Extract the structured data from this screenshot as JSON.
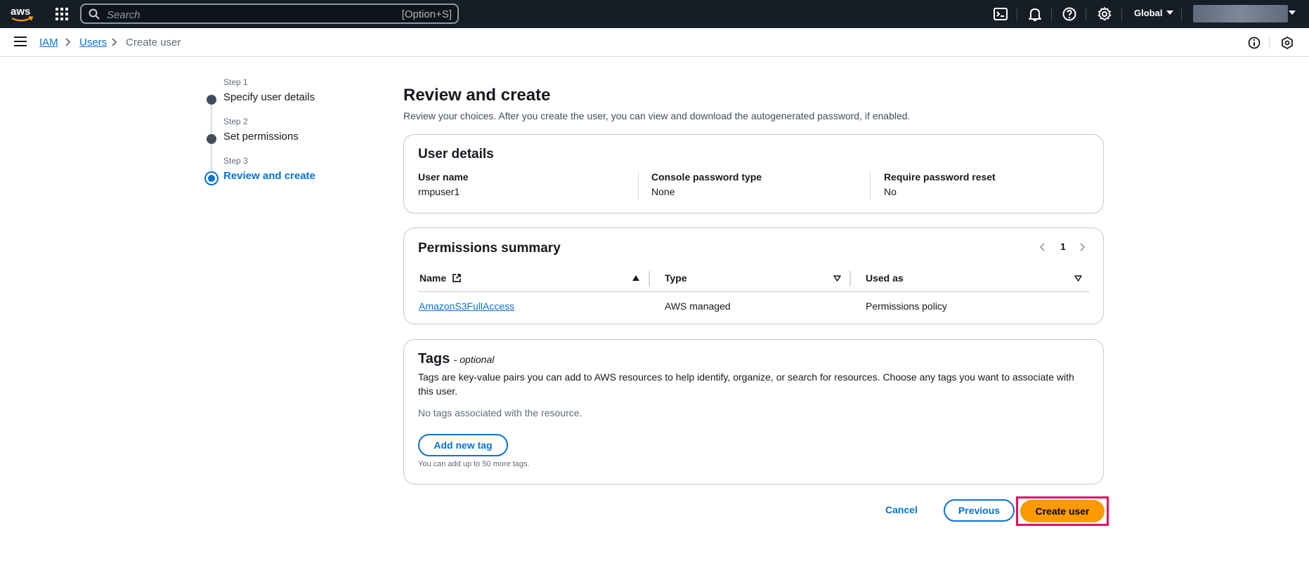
{
  "topnav": {
    "logo_text": "aws",
    "search_placeholder": "Search",
    "search_shortcut": "[Option+S]",
    "region": "Global",
    "icons": [
      "apps-grid-icon",
      "cloudshell-icon",
      "bell-icon",
      "help-icon",
      "settings-icon"
    ],
    "background_color": "#161d26"
  },
  "breadcrumb": {
    "items": [
      "IAM",
      "Users",
      "Create user"
    ]
  },
  "wizard": {
    "steps": [
      {
        "number": "Step 1",
        "label": "Specify user details",
        "state": "complete"
      },
      {
        "number": "Step 2",
        "label": "Set permissions",
        "state": "complete"
      },
      {
        "number": "Step 3",
        "label": "Review and create",
        "state": "active"
      }
    ]
  },
  "main": {
    "title": "Review and create",
    "description": "Review your choices. After you create the user, you can view and download the autogenerated password, if enabled."
  },
  "user_details": {
    "heading": "User details",
    "fields": [
      {
        "key": "User name",
        "value": "rmpuser1"
      },
      {
        "key": "Console password type",
        "value": "None"
      },
      {
        "key": "Require password reset",
        "value": "No"
      }
    ]
  },
  "permissions": {
    "heading": "Permissions summary",
    "page": "1",
    "columns": [
      "Name",
      "Type",
      "Used as"
    ],
    "rows": [
      {
        "name": "AmazonS3FullAccess",
        "type": "AWS managed",
        "used_as": "Permissions policy"
      }
    ]
  },
  "tags": {
    "heading": "Tags",
    "optional": "- optional",
    "description": "Tags are key-value pairs you can add to AWS resources to help identify, organize, or search for resources. Choose any tags you want to associate with this user.",
    "empty_text": "No tags associated with the resource.",
    "add_button": "Add new tag",
    "hint": "You can add up to 50 more tags."
  },
  "actions": {
    "cancel": "Cancel",
    "previous": "Previous",
    "create": "Create user"
  },
  "colors": {
    "accent": "#0972d3",
    "primary_button": "#ff9900",
    "highlight_box": "#e0115f"
  }
}
